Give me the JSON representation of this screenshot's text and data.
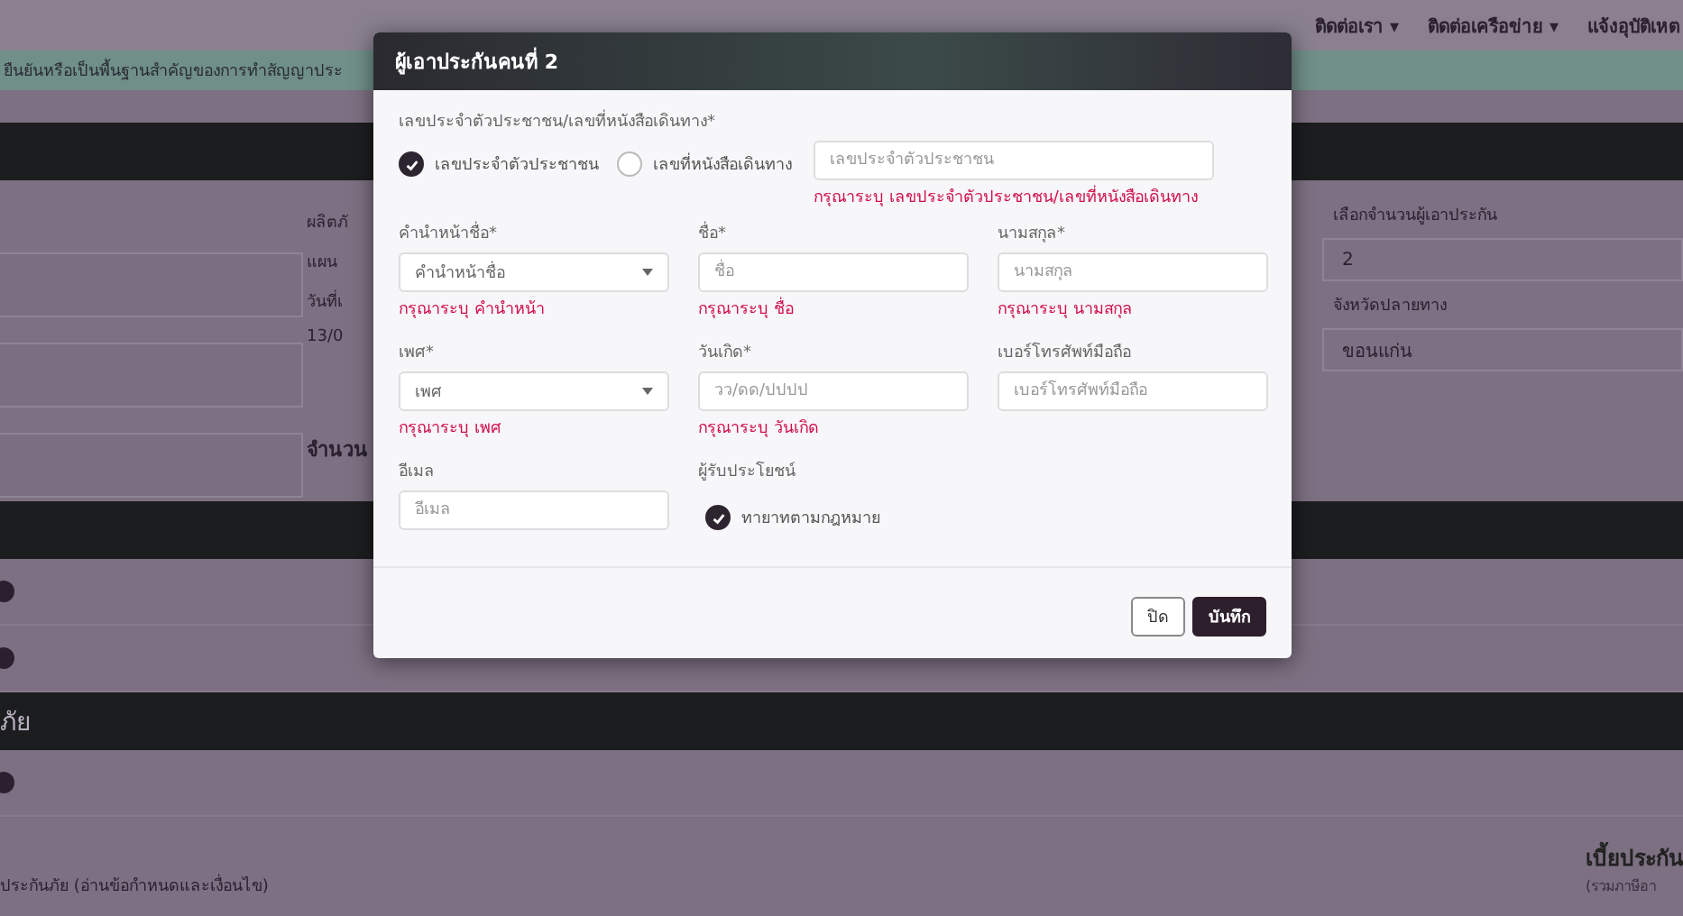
{
  "background": {
    "nav_items": [
      "ติดต่อเรา ▾",
      "ติดต่อเครือข่าย ▾",
      "แจ้งอุบัติเหต"
    ],
    "banner": "ยืนยันหรือเป็นพื้นฐานสำคัญของการทำสัญญาประ",
    "left_labels": [
      "ผลิตภั",
      "แผน",
      "วันที่เ",
      "13/0"
    ],
    "right_fields": [
      {
        "label": "เลือกจำนวนผู้เอาประกัน",
        "value": "2"
      },
      {
        "label": "จังหวัดปลายทาง",
        "value": "ขอนแก่น"
      }
    ],
    "count_label": "จำนวน",
    "section_title": "ภัย",
    "terms": "ประกันภัย (อ่านข้อกำหนดและเงื่อนไข)",
    "premium_title": "เบี้ยประกัน",
    "premium_note": "(รวมภาษีอา"
  },
  "modal": {
    "title": "ผู้เอาประกันคนที่ 2",
    "id_label": "เลขประจำตัวประชาชน/เลขที่หนังสือเดินทาง*",
    "id_options": [
      {
        "label": "เลขประจำตัวประชาชน",
        "selected": true
      },
      {
        "label": "เลขที่หนังสือเดินทาง",
        "selected": false
      }
    ],
    "id_placeholder": "เลขประจำตัวประชาชน",
    "id_error": "กรุณาระบุ เลขประจำตัวประชาชน/เลขที่หนังสือเดินทาง",
    "fields": [
      {
        "kind": "select",
        "label": "คำนำหน้าชื่อ*",
        "placeholder": "คำนำหน้าชื่อ",
        "error": "กรุณาระบุ คำนำหน้า"
      },
      {
        "kind": "input",
        "label": "ชื่อ*",
        "placeholder": "ชื่อ",
        "error": "กรุณาระบุ ชื่อ"
      },
      {
        "kind": "input",
        "label": "นามสกุล*",
        "placeholder": "นามสกุล",
        "error": "กรุณาระบุ นามสกุล"
      },
      {
        "kind": "select",
        "label": "เพศ*",
        "placeholder": "เพศ",
        "error": "กรุณาระบุ เพศ"
      },
      {
        "kind": "input",
        "label": "วันเกิด*",
        "placeholder": "วว/ดด/ปปปป",
        "error": "กรุณาระบุ วันเกิด"
      },
      {
        "kind": "input",
        "label": "เบอร์โทรศัพท์มือถือ",
        "placeholder": "เบอร์โทรศัพท์มือถือ"
      },
      {
        "kind": "input",
        "label": "อีเมล",
        "placeholder": "อีเมล"
      }
    ],
    "beneficiary_label": "ผู้รับประโยชน์",
    "beneficiary": {
      "label": "ทายาทตามกฎหมาย",
      "checked": true
    },
    "buttons": [
      {
        "kind": "outline",
        "label": "ปิด"
      },
      {
        "kind": "primary",
        "label": "บันทึก"
      }
    ]
  }
}
